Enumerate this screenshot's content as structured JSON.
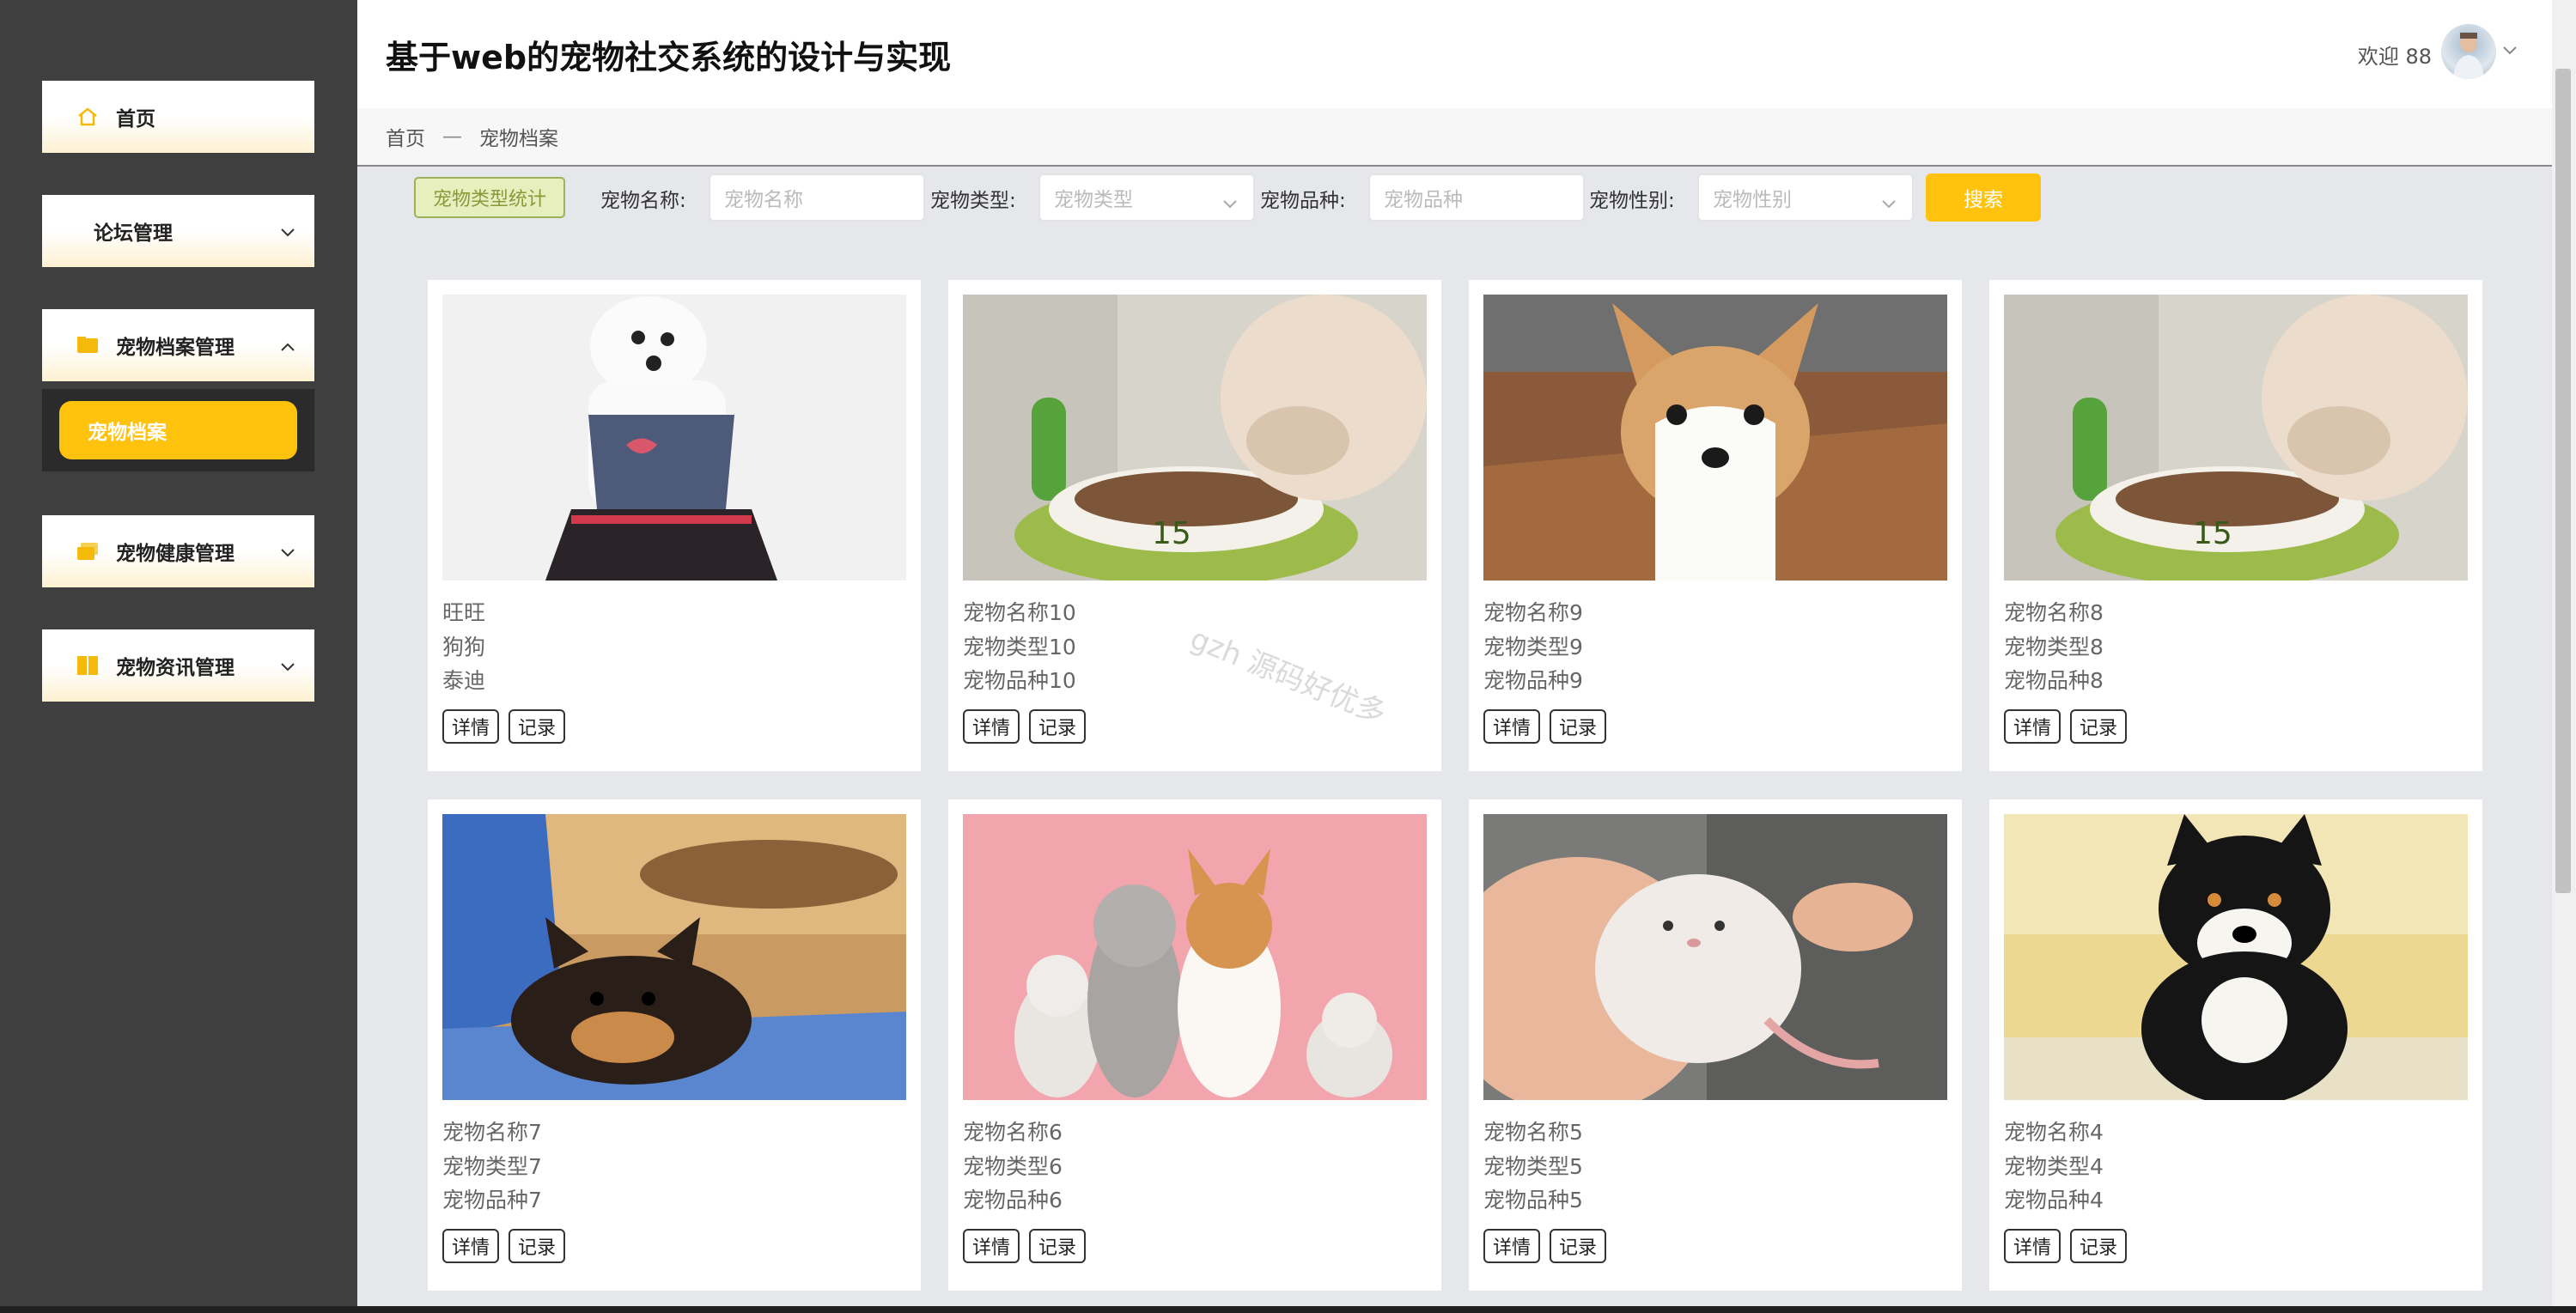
{
  "app": {
    "title": "基于web的宠物社交系统的设计与实现"
  },
  "user": {
    "welcome": "欢迎 88"
  },
  "sidebar": {
    "items": [
      {
        "label": "首页",
        "icon": "home-icon"
      },
      {
        "label": "论坛管理"
      },
      {
        "label": "宠物档案管理",
        "icon": "folder-icon",
        "expanded": true,
        "sub": "宠物档案"
      },
      {
        "label": "宠物健康管理",
        "icon": "folders-icon"
      },
      {
        "label": "宠物资讯管理",
        "icon": "book-icon"
      }
    ]
  },
  "breadcrumb": {
    "home": "首页",
    "sep": "—",
    "current": "宠物档案"
  },
  "filters": {
    "stat_button": "宠物类型统计",
    "name_label": "宠物名称:",
    "name_placeholder": "宠物名称",
    "type_label": "宠物类型:",
    "type_placeholder": "宠物类型",
    "breed_label": "宠物品种:",
    "breed_placeholder": "宠物品种",
    "sex_label": "宠物性别:",
    "sex_placeholder": "宠物性别",
    "search_button": "搜索"
  },
  "card_buttons": {
    "detail": "详情",
    "record": "记录"
  },
  "pets": [
    {
      "name": "旺旺",
      "type": "狗狗",
      "breed": "泰迪",
      "photo": "white-poodle"
    },
    {
      "name": "宠物名称10",
      "type": "宠物类型10",
      "breed": "宠物品种10",
      "photo": "cat-food-bowl"
    },
    {
      "name": "宠物名称9",
      "type": "宠物类型9",
      "breed": "宠物品种9",
      "photo": "corgi-puppy"
    },
    {
      "name": "宠物名称8",
      "type": "宠物类型8",
      "breed": "宠物品种8",
      "photo": "cat-food-bowl"
    },
    {
      "name": "宠物名称7",
      "type": "宠物类型7",
      "breed": "宠物品种7",
      "photo": "shiba-lying"
    },
    {
      "name": "宠物名称6",
      "type": "宠物类型6",
      "breed": "宠物品种6",
      "photo": "pets-group-pink"
    },
    {
      "name": "宠物名称5",
      "type": "宠物类型5",
      "breed": "宠物品种5",
      "photo": "hamster-hand"
    },
    {
      "name": "宠物名称4",
      "type": "宠物类型4",
      "breed": "宠物品种4",
      "photo": "shiba-puppy"
    }
  ],
  "watermark": "gzh 源码好优多",
  "colors": {
    "accent": "#ffc30e",
    "sidebar": "#3f3f3f",
    "content_bg": "#e5e7ea"
  }
}
